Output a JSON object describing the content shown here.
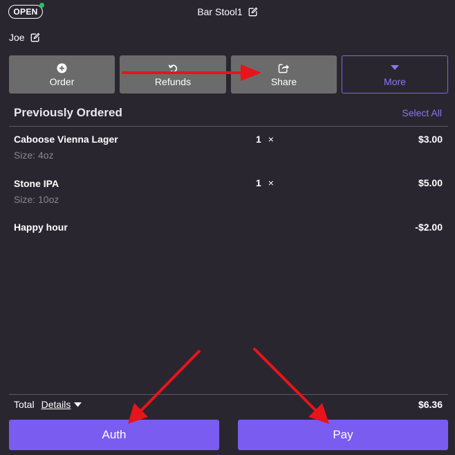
{
  "header": {
    "status": "OPEN",
    "status_dot_color": "#1ec95c",
    "table_name": "Bar Stool1",
    "customer_name": "Joe"
  },
  "actions": {
    "order": "Order",
    "refunds": "Refunds",
    "share": "Share",
    "more": "More"
  },
  "order": {
    "section_title": "Previously Ordered",
    "select_all": "Select All",
    "items": [
      {
        "name": "Caboose Vienna Lager",
        "size": "Size: 4oz",
        "qty": "1",
        "qty_sep": "×",
        "price": "$3.00"
      },
      {
        "name": "Stone IPA",
        "size": "Size: 10oz",
        "qty": "1",
        "qty_sep": "×",
        "price": "$5.00"
      },
      {
        "name": "Happy hour",
        "price": "-$2.00"
      }
    ]
  },
  "footer": {
    "total_label": "Total",
    "details_label": "Details",
    "total_value": "$6.36",
    "auth_label": "Auth",
    "pay_label": "Pay"
  },
  "colors": {
    "background": "#2a2630",
    "accent": "#7a5cf0",
    "button_gray": "#6b6b6b",
    "annotation_arrow": "#e8141b"
  }
}
